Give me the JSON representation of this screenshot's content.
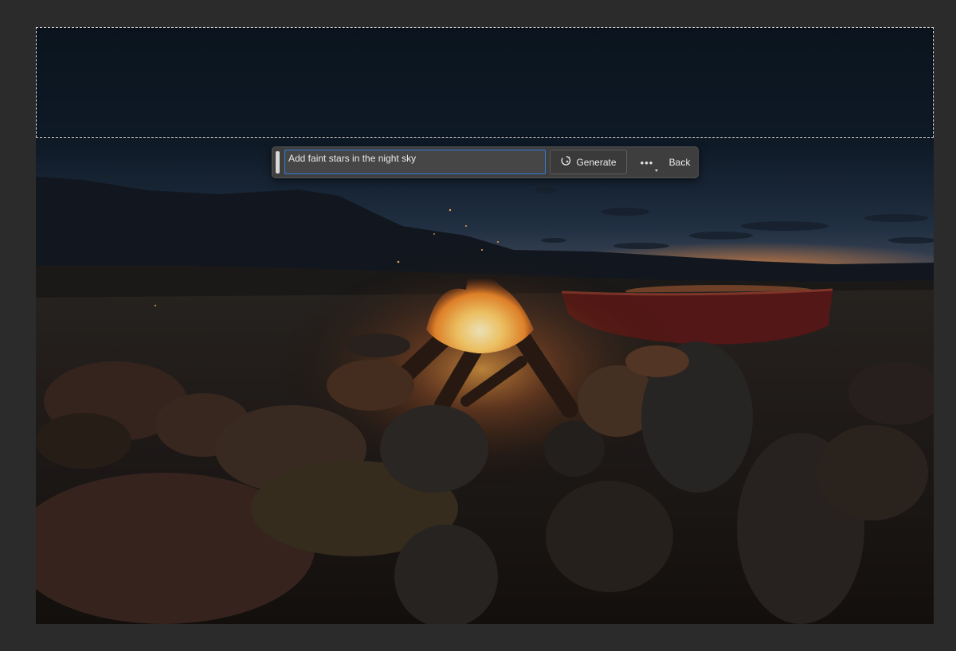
{
  "document": {
    "image_subject": "campfire-by-lake-at-dusk",
    "selection_style": "marching-ants"
  },
  "contextual_taskbar": {
    "prompt_value": "Add faint stars in the night sky",
    "generate_label": "Generate",
    "generate_icon": "generative-sparkle-icon",
    "more_icon": "more-options-icon",
    "more_glyph": "•••",
    "back_label": "Back"
  },
  "colors": {
    "workspace_bg": "#2b2b2b",
    "taskbar_bg": "#3e3e3e",
    "input_focus_border": "#2f7de1",
    "sky_dark": "#0e1722",
    "fire": "#ffb347"
  }
}
